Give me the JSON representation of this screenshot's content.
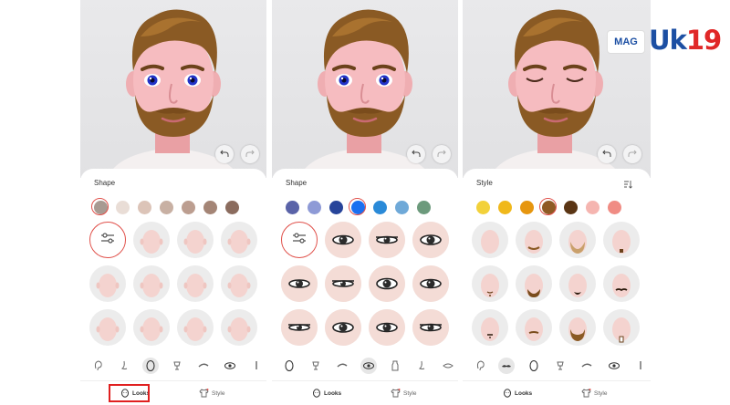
{
  "colors": {
    "selection_red": "#e0504a",
    "brand_blue": "#1c4fa3",
    "brand_red": "#e02828"
  },
  "logo": {
    "badge": "MAG",
    "text_a": "U",
    "text_b": "k",
    "text_c": "19"
  },
  "panels": [
    {
      "title": "Shape",
      "swatches": [
        "#a89a92",
        "#e9ddd6",
        "#dcc4b8",
        "#c8b0a3",
        "#bc9e90",
        "#a48576",
        "#8b6c5e"
      ],
      "selected_swatch": 0,
      "grid_type": "face",
      "tools": [
        "ear-icon",
        "nose-icon",
        "face-shape-icon",
        "lamp-icon",
        "brow-icon",
        "eye-icon",
        "more-icon"
      ],
      "active_tool": 2
    },
    {
      "title": "Shape",
      "swatches": [
        "#5a63a8",
        "#8e9ad6",
        "#27449a",
        "#1a6ff0",
        "#2a8ad8",
        "#6fa9d8",
        "#6c9a7c"
      ],
      "selected_swatch": 3,
      "grid_type": "eye",
      "tools": [
        "face-shape-icon",
        "lamp-icon",
        "brow-icon",
        "eye-icon",
        "bottle-icon",
        "nose-icon",
        "lips-icon"
      ],
      "active_tool": 3
    },
    {
      "title": "Style",
      "swatches": [
        "#f2d13a",
        "#f0b81b",
        "#e6960f",
        "#8f5a24",
        "#5a3514",
        "#f5b5b0",
        "#f08c84"
      ],
      "selected_swatch": 3,
      "grid_type": "beard",
      "tools": [
        "ear-icon",
        "mustache-icon",
        "face-shape-icon",
        "lamp-icon",
        "brow-icon",
        "eye-icon",
        "more-icon"
      ],
      "active_tool": 1
    }
  ],
  "tabs": {
    "looks": "Looks",
    "style": "Style"
  }
}
